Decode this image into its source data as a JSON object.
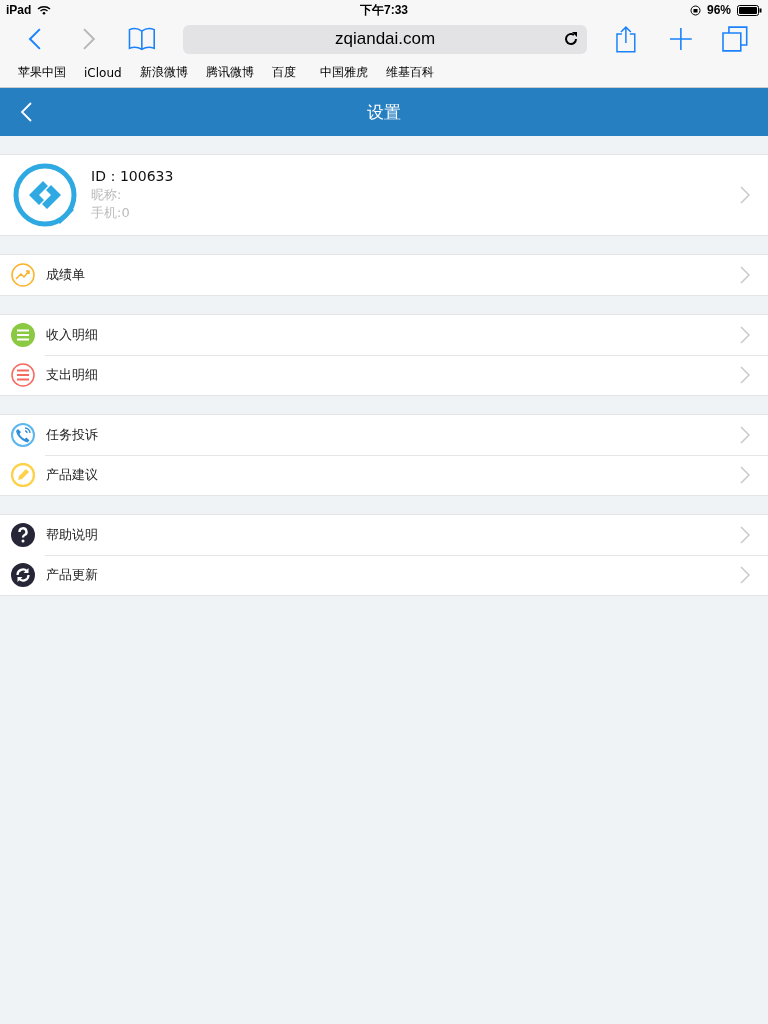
{
  "status_bar": {
    "device": "iPad",
    "time": "下午7:33",
    "battery": "96%"
  },
  "browser": {
    "url": "zqiandai.com",
    "bookmarks": [
      "苹果中国",
      "iCloud",
      "新浪微博",
      "腾讯微博",
      "百度",
      "中国雅虎",
      "维基百科"
    ]
  },
  "nav": {
    "title": "设置"
  },
  "profile": {
    "id": "ID：100633",
    "nickname": "昵称:",
    "phone": "手机:0"
  },
  "groups": [
    [
      {
        "kind": "chart",
        "label": "成绩单"
      }
    ],
    [
      {
        "kind": "income",
        "label": "收入明细"
      },
      {
        "kind": "expense",
        "label": "支出明细"
      }
    ],
    [
      {
        "kind": "phone",
        "label": "任务投诉"
      },
      {
        "kind": "pencil",
        "label": "产品建议"
      }
    ],
    [
      {
        "kind": "help",
        "label": "帮助说明"
      },
      {
        "kind": "refresh",
        "label": "产品更新"
      }
    ]
  ]
}
